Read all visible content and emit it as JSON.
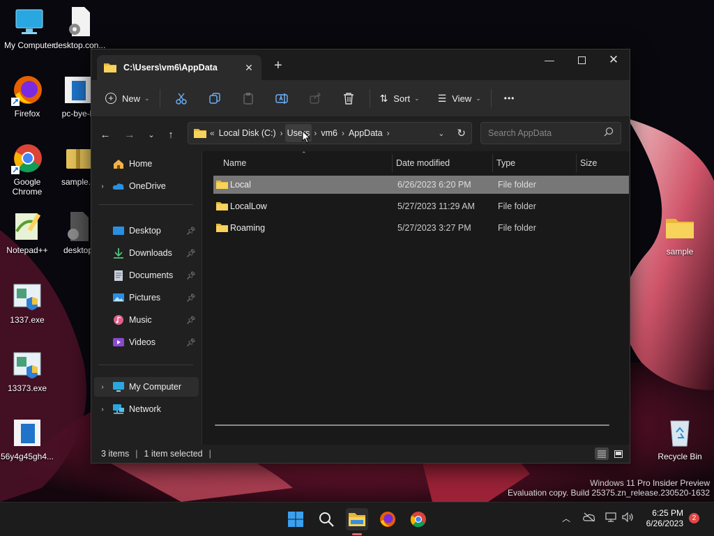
{
  "desktop": {
    "icons": [
      {
        "label": "My Computer"
      },
      {
        "label": "desktop.con..."
      },
      {
        "label": "Firefox"
      },
      {
        "label": "pc-bye-b"
      },
      {
        "label": "Google Chrome"
      },
      {
        "label": "sample.c"
      },
      {
        "label": "Notepad++"
      },
      {
        "label": "desktop"
      },
      {
        "label": "1337.exe"
      },
      {
        "label": "13373.exe"
      },
      {
        "label": "56y4g45gh4..."
      },
      {
        "label": "sample"
      },
      {
        "label": "Recycle Bin"
      }
    ],
    "watermark": {
      "line1": "Windows 11 Pro Insider Preview",
      "line2": "Evaluation copy. Build 25375.zn_release.230520-1632"
    }
  },
  "window": {
    "tab_title": "C:\\Users\\vm6\\AppData",
    "toolbar": {
      "new_label": "New",
      "sort_label": "Sort",
      "view_label": "View",
      "more_label": "•••"
    },
    "breadcrumb": {
      "overflow": "«",
      "items": [
        "Local Disk (C:)",
        "Users",
        "vm6",
        "AppData"
      ]
    },
    "search": {
      "placeholder": "Search AppData"
    },
    "nav": {
      "home": "Home",
      "onedrive": "OneDrive",
      "quick": [
        "Desktop",
        "Downloads",
        "Documents",
        "Pictures",
        "Music",
        "Videos"
      ],
      "mycomputer": "My Computer",
      "network": "Network"
    },
    "columns": {
      "name": "Name",
      "date": "Date modified",
      "type": "Type",
      "size": "Size"
    },
    "files": [
      {
        "name": "Local",
        "date": "6/26/2023 6:20 PM",
        "type": "File folder",
        "selected": true
      },
      {
        "name": "LocalLow",
        "date": "5/27/2023 11:29 AM",
        "type": "File folder",
        "selected": false
      },
      {
        "name": "Roaming",
        "date": "5/27/2023 3:27 PM",
        "type": "File folder",
        "selected": false
      }
    ],
    "status": {
      "items": "3 items",
      "selected": "1 item selected",
      "sep": "|"
    }
  },
  "taskbar": {
    "time": "6:25 PM",
    "date": "6/26/2023",
    "notifications": "2"
  },
  "colors": {
    "accent": "#0078d4",
    "folder": "#f3c846",
    "selection": "#777777"
  }
}
